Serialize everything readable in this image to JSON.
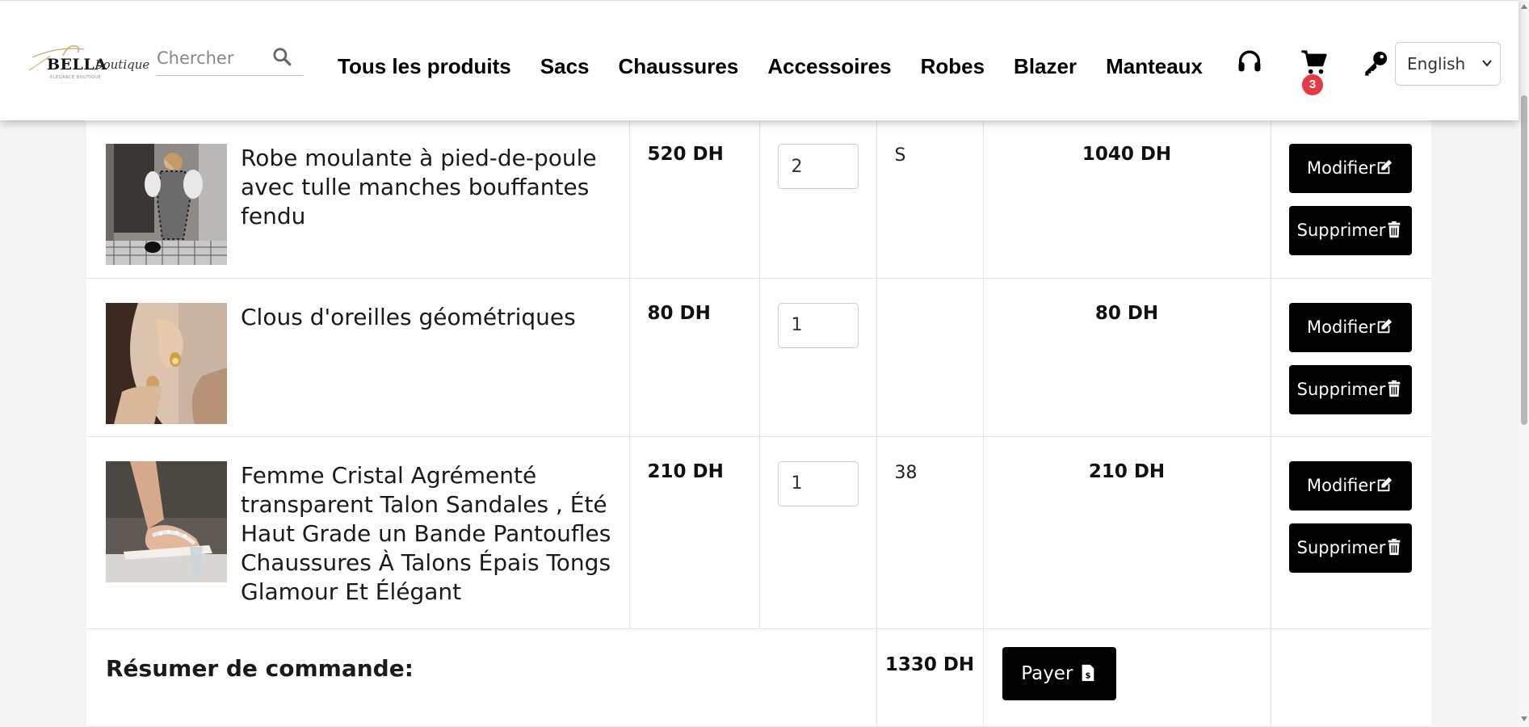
{
  "header": {
    "logo_text": "BELLA",
    "logo_script": "boutique",
    "logo_sub": "ELEGANCE BOUTIQUE",
    "search_placeholder": "Chercher",
    "nav": [
      "Tous les produits",
      "Sacs",
      "Chaussures",
      "Accessoires",
      "Robes",
      "Blazer",
      "Manteaux"
    ],
    "cart_count": "3",
    "language": "English",
    "language_options": [
      "English"
    ],
    "icons": [
      "headset-icon",
      "cart-icon",
      "key-icon",
      "search-icon"
    ]
  },
  "cart": {
    "items": [
      {
        "name": "Robe moulante à pied-de-poule avec tulle manches bouffantes fendu",
        "price": "520 DH",
        "qty": "2",
        "size": "S",
        "total": "1040 DH",
        "image": "houndstooth-dress-photo"
      },
      {
        "name": "Clous d'oreilles géométriques",
        "price": "80 DH",
        "qty": "1",
        "size": "",
        "total": "80 DH",
        "image": "earring-photo"
      },
      {
        "name": "Femme Cristal Agrémenté transparent Talon Sandales , Été Haut Grade un Bande Pantoufles Chaussures À Talons Épais Tongs Glamour Et Élégant",
        "price": "210 DH",
        "qty": "1",
        "size": "38",
        "total": "210 DH",
        "image": "sandal-photo"
      }
    ],
    "edit_label": "Modifier",
    "delete_label": "Supprimer",
    "summary_label": "Résumer de commande:",
    "summary_total": "1330 DH",
    "pay_label": "Payer"
  },
  "colors": {
    "button": "#000000",
    "badge": "#e53945",
    "background": "#f4f4f4"
  }
}
